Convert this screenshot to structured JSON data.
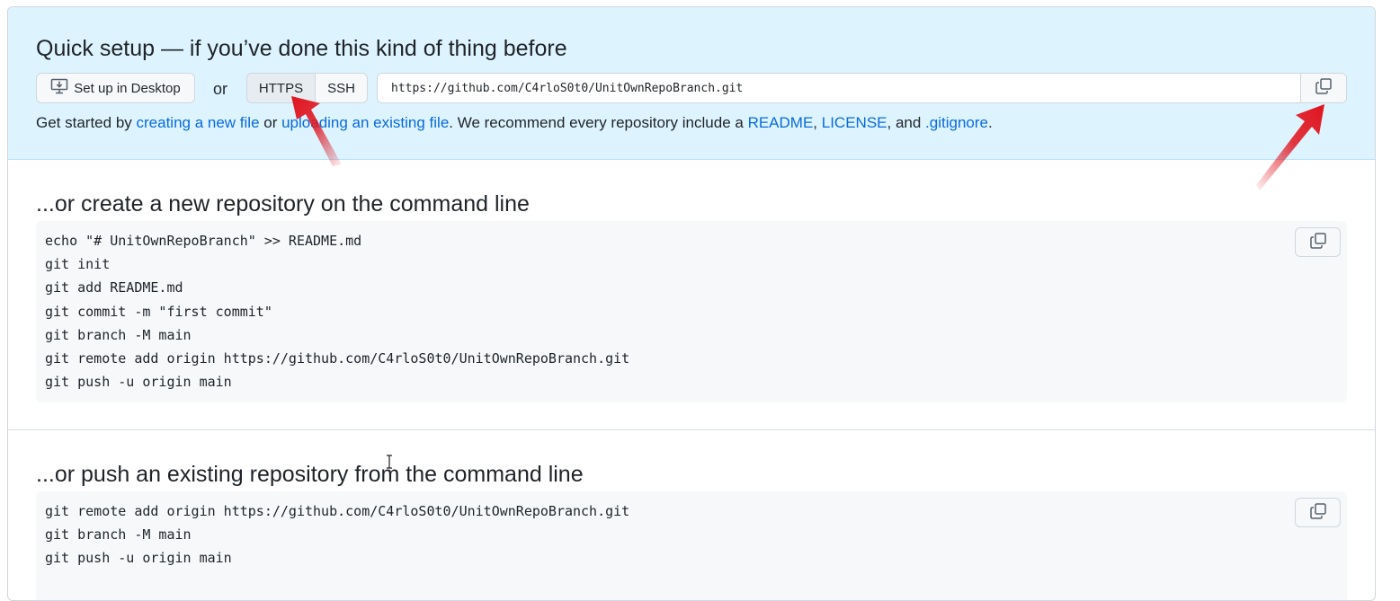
{
  "quick_setup": {
    "title": "Quick setup — if you’ve done this kind of thing before",
    "desktop_button": "Set up in Desktop",
    "or_label": "or",
    "protocols": [
      "HTTPS",
      "SSH"
    ],
    "selected_protocol": "HTTPS",
    "clone_url": "https://github.com/C4rloS0t0/UnitOwnRepoBranch.git",
    "hint": {
      "prefix": "Get started by ",
      "link_new_file": "creating a new file",
      "mid1": " or ",
      "link_upload": "uploading an existing file",
      "mid2": ". We recommend every repository include a ",
      "link_readme": "README",
      "comma": ", ",
      "link_license": "LICENSE",
      "mid3": ", and ",
      "link_gitignore": ".gitignore",
      "suffix": "."
    }
  },
  "new_repo": {
    "title": "...or create a new repository on the command line",
    "lines": [
      "echo \"# UnitOwnRepoBranch\" >> README.md",
      "git init",
      "git add README.md",
      "git commit -m \"first commit\"",
      "git branch -M main",
      "git remote add origin https://github.com/C4rloS0t0/UnitOwnRepoBranch.git",
      "git push -u origin main"
    ]
  },
  "existing_repo": {
    "title": "...or push an existing repository from the command line",
    "lines": [
      "git remote add origin https://github.com/C4rloS0t0/UnitOwnRepoBranch.git",
      "git branch -M main",
      "git push -u origin main"
    ]
  },
  "icons": {
    "desktop": "desktop-download-icon",
    "copy": "copy-icon",
    "annotation": "red-arrow-icon"
  },
  "colors": {
    "quick_bg": "#ddf4ff",
    "link": "#0969da",
    "code_bg": "#f6f8fa",
    "annotation_arrow": "#e0141e"
  }
}
